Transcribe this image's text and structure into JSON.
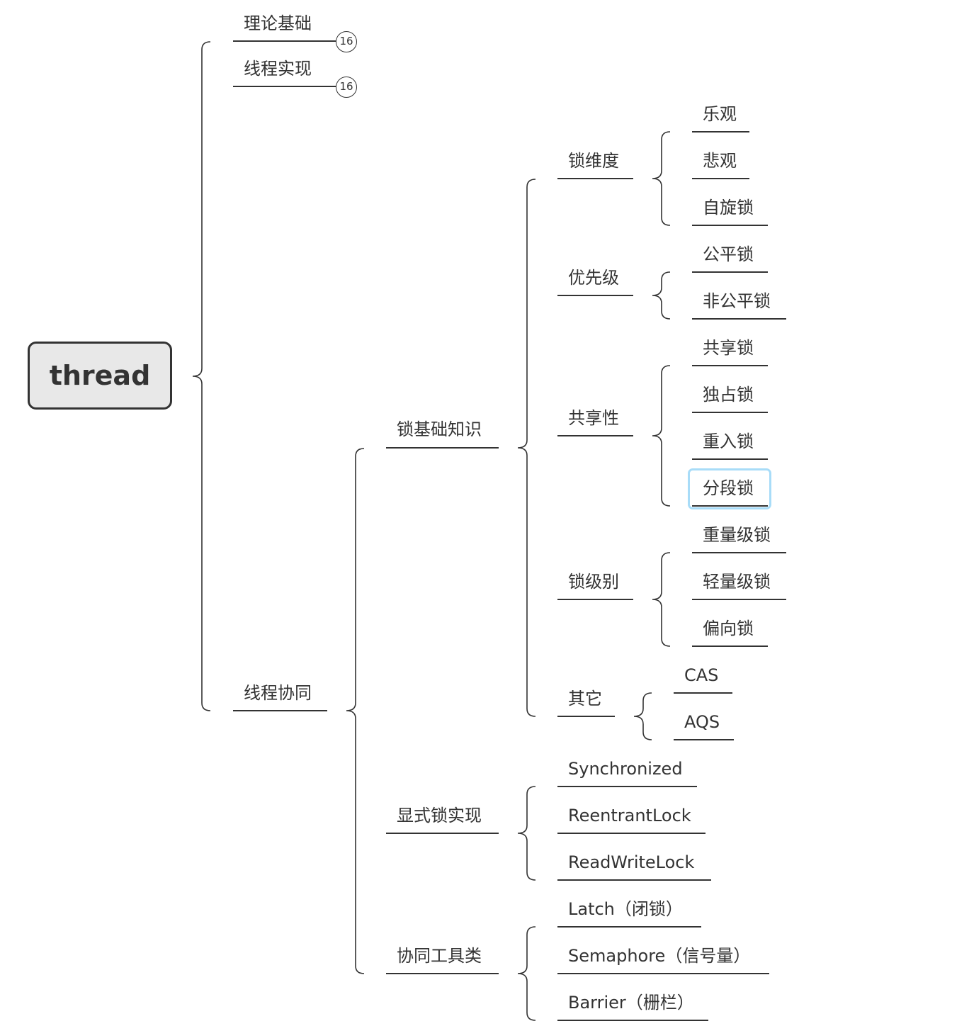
{
  "root": {
    "label": "thread"
  },
  "branches": [
    {
      "label": "理论基础",
      "collapsed_count": "16"
    },
    {
      "label": "线程实现",
      "collapsed_count": "16"
    },
    {
      "label": "线程协同",
      "children": [
        {
          "label": "锁基础知识",
          "children": [
            {
              "label": "锁维度",
              "children": [
                "乐观",
                "悲观",
                "自旋锁"
              ]
            },
            {
              "label": "优先级",
              "children": [
                "公平锁",
                "非公平锁"
              ]
            },
            {
              "label": "共享性",
              "children": [
                "共享锁",
                "独占锁",
                "重入锁",
                "分段锁"
              ]
            },
            {
              "label": "锁级别",
              "children": [
                "重量级锁",
                "轻量级锁",
                "偏向锁"
              ]
            },
            {
              "label": "其它",
              "children": [
                "CAS",
                "AQS"
              ]
            }
          ]
        },
        {
          "label": "显式锁实现",
          "children": [
            "Synchronized",
            "ReentrantLock",
            "ReadWriteLock"
          ]
        },
        {
          "label": "协同工具类",
          "children": [
            "Latch（闭锁）",
            "Semaphore（信号量）",
            "Barrier（栅栏）"
          ]
        }
      ]
    }
  ],
  "selected_topic": "分段锁",
  "colors": {
    "line": "#333333",
    "selection": "#a8dcf8",
    "root_fill": "#e8e8e8"
  }
}
